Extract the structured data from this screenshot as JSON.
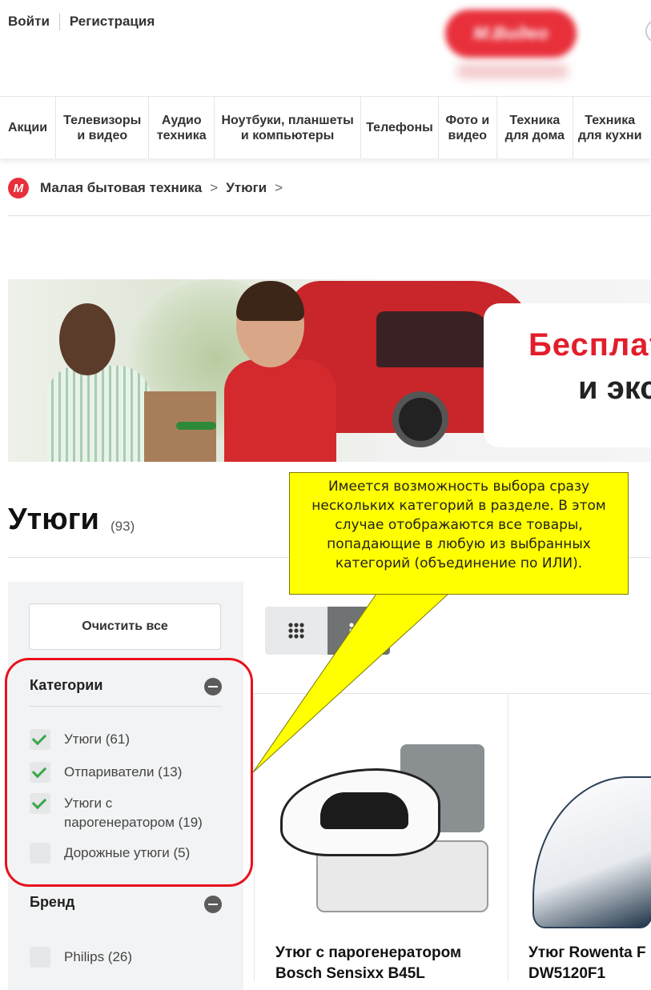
{
  "header": {
    "login": "Войти",
    "register": "Регистрация",
    "logo_text": "М.Видео"
  },
  "nav": {
    "items": [
      {
        "label": "Акции"
      },
      {
        "label": "Телевизоры\nи видео"
      },
      {
        "label": "Аудио\nтехника"
      },
      {
        "label": "Ноутбуки, планшеты\nи компьютеры"
      },
      {
        "label": "Телефоны"
      },
      {
        "label": "Фото и\nвидео"
      },
      {
        "label": "Техника\nдля дома"
      },
      {
        "label": "Техника\nдля кухни"
      }
    ]
  },
  "breadcrumb": {
    "logo_letter": "М",
    "items": [
      "Малая бытовая техника",
      "Утюги"
    ],
    "separator": ">"
  },
  "banner": {
    "line1": "Бесплатная",
    "line2": "и экспресс"
  },
  "page": {
    "title": "Утюги",
    "count": "(93)"
  },
  "filters": {
    "clear_all": "Очистить все",
    "categories": {
      "title": "Категории",
      "options": [
        {
          "label": "Утюги (61)",
          "checked": true
        },
        {
          "label": "Отпариватели (13)",
          "checked": true
        },
        {
          "label": "Утюги с\nпарогенератором (19)",
          "checked": true
        },
        {
          "label": "Дорожные утюги (5)",
          "checked": false
        }
      ]
    },
    "brand": {
      "title": "Бренд",
      "options": [
        {
          "label": "Philips (26)",
          "checked": false
        }
      ]
    }
  },
  "view_toggle": {
    "active": "list"
  },
  "products": [
    {
      "name_line1": "Утюг с парогенератором",
      "name_line2": "Bosch Sensixx B45L"
    },
    {
      "name_line1": "Утюг Rowenta F",
      "name_line2": "DW5120F1"
    }
  ],
  "callout": {
    "text": "Имеется возможность выбора сразу нескольких категорий в разделе. В этом случае отображаются все товары, попадающие в любую из выбранных категорий (объединение по ИЛИ)."
  },
  "colors": {
    "brand_red": "#e8303b",
    "highlight_red": "#e8101b",
    "callout_yellow": "#ffff00",
    "check_green": "#3aa648"
  }
}
